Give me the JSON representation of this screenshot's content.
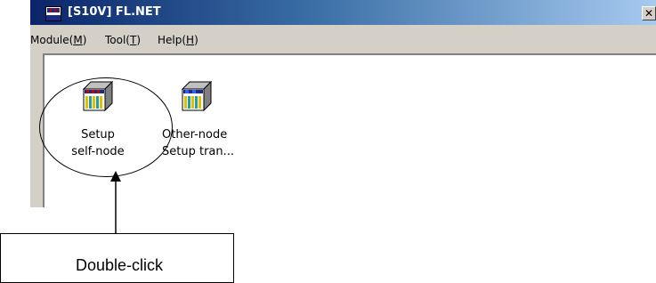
{
  "window": {
    "title": "[S10V] FL.NET",
    "close_glyph": "✕"
  },
  "menubar": {
    "items": [
      {
        "label": "Module(",
        "accel": "M",
        "end": ")"
      },
      {
        "label": "Tool(",
        "accel": "T",
        "end": ")"
      },
      {
        "label": "Help(",
        "accel": "H",
        "end": ")"
      }
    ]
  },
  "nodes": [
    {
      "icon": "setup-self-node-icon",
      "line1": "Setup",
      "line2": "self-node"
    },
    {
      "icon": "other-node-setup-icon",
      "line1": "Other-node",
      "line2": "Setup tran..."
    }
  ],
  "annotation": {
    "callout_text": "Double-click"
  },
  "colors": {
    "title_bar_start": "#0a246a",
    "title_bar_end": "#a6caf0",
    "window_face": "#d4d0c8"
  }
}
